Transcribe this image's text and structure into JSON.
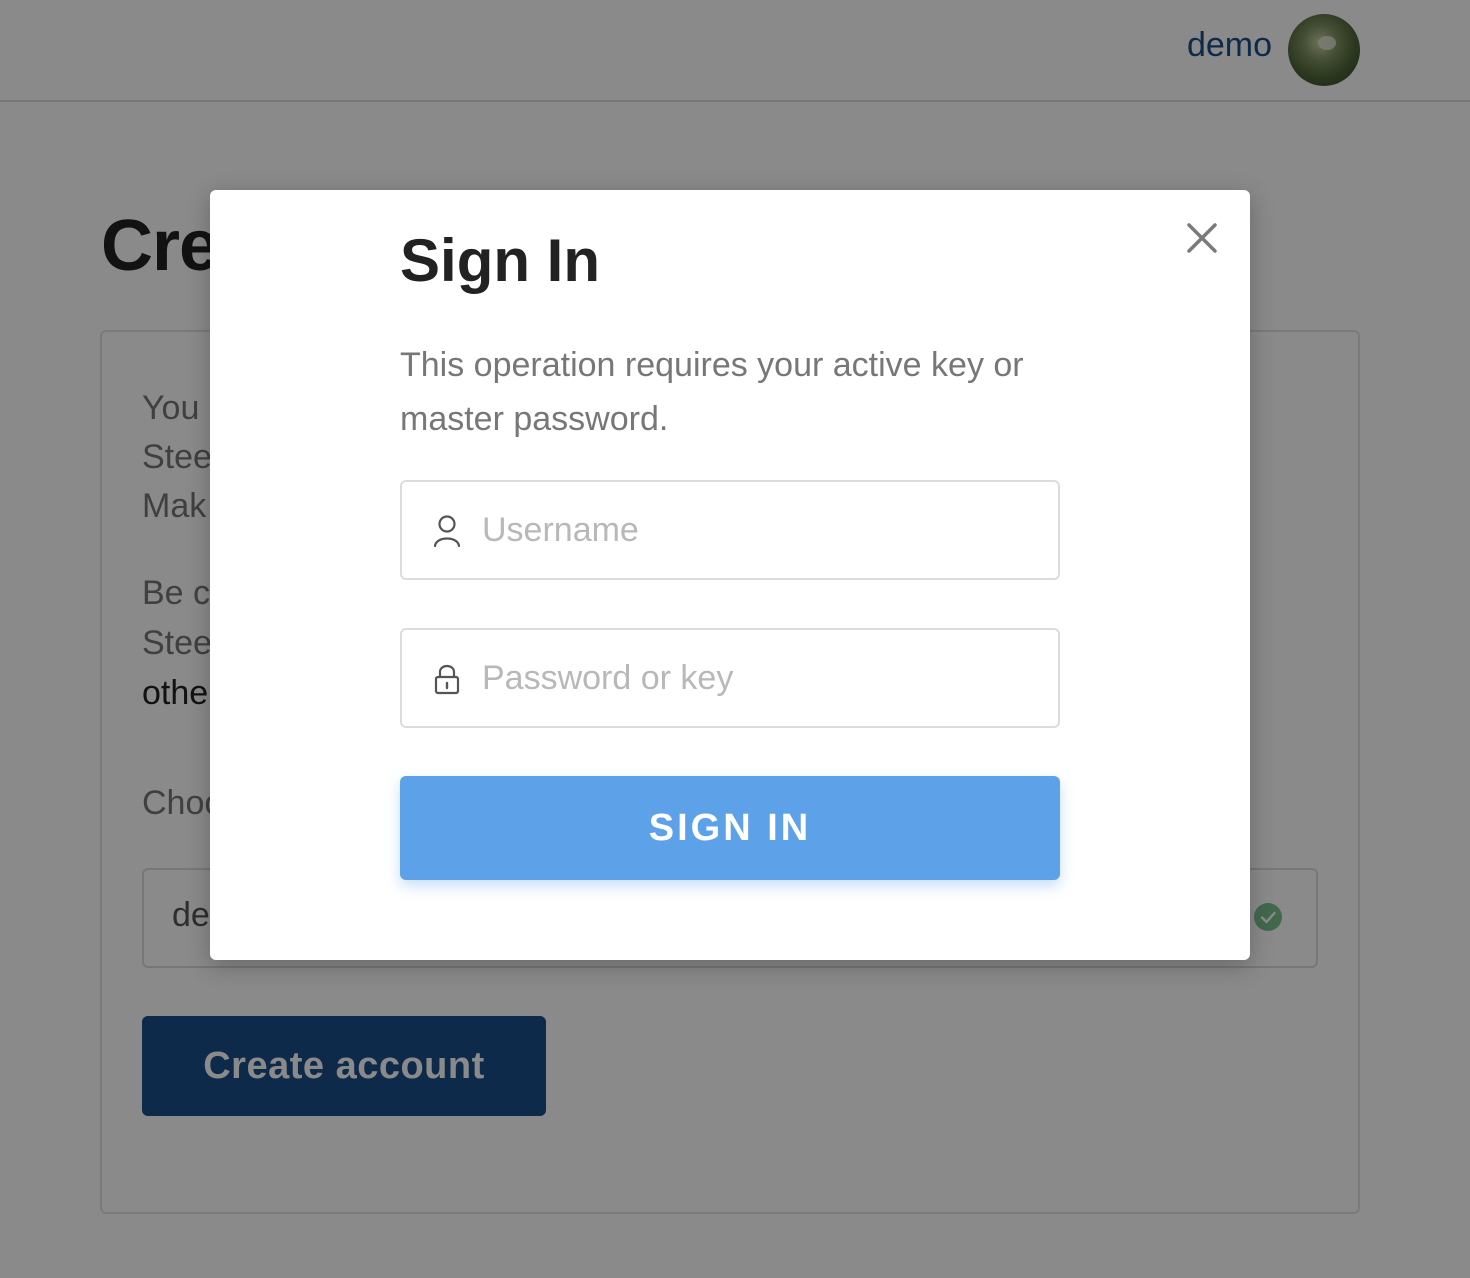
{
  "header": {
    "username": "demo"
  },
  "background_page": {
    "title": "Create Account",
    "lines": [
      "You",
      "Stee",
      "Mak",
      "Be ca",
      "Stee",
      "othe",
      "Choo"
    ],
    "account_name_value": "de",
    "create_button_label": "Create account"
  },
  "modal": {
    "title": "Sign In",
    "description": "This operation requires your active key or master password.",
    "username_placeholder": "Username",
    "password_placeholder": "Password or key",
    "submit_label": "SIGN IN"
  },
  "colors": {
    "accent": "#5da1e8",
    "brand_dark": "#1a4f8b",
    "valid_check": "#79c38d"
  },
  "icons": {
    "close": "close-icon",
    "user": "user-icon",
    "lock": "lock-icon",
    "check": "check-icon"
  }
}
